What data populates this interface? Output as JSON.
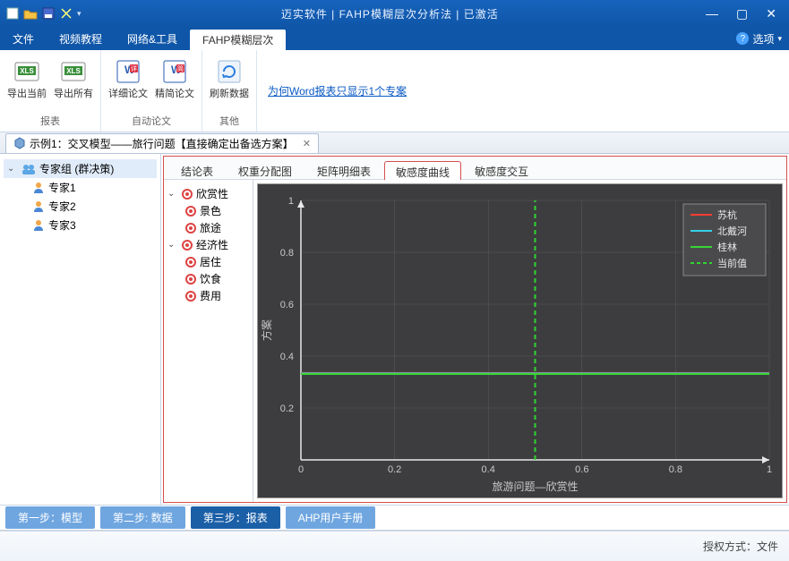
{
  "title": "迈实软件 | FAHP模糊层次分析法 | 已激活",
  "menu": {
    "file": "文件",
    "video": "视频教程",
    "net": "网络&工具",
    "fahp": "FAHP模糊层次",
    "options": "选项"
  },
  "ribbon": {
    "export_current": "导出当前",
    "export_all": "导出所有",
    "detail_paper": "详细论文",
    "simple_paper": "精简论文",
    "refresh": "刷新数据",
    "group_report": "报表",
    "group_autopaper": "自动论文",
    "group_other": "其他",
    "link": "为何Word报表只显示1个专案"
  },
  "doc_tab": {
    "label": "示例1：交叉模型——旅行问题【直接确定出备选方案】"
  },
  "left_tree": {
    "root": "专家组 (群决策)",
    "items": [
      "专家1",
      "专家2",
      "专家3"
    ]
  },
  "sub_tabs": [
    "结论表",
    "权重分配图",
    "矩阵明细表",
    "敏感度曲线",
    "敏感度交互"
  ],
  "crit_tree": {
    "n1": {
      "label": "欣赏性",
      "children": [
        "景色",
        "旅途"
      ]
    },
    "n2": {
      "label": "经济性",
      "children": [
        "居住",
        "饮食",
        "费用"
      ]
    }
  },
  "chart_data": {
    "type": "line",
    "title": "",
    "xlabel": "旅游问题—欣赏性",
    "ylabel": "方案",
    "xlim": [
      0,
      1
    ],
    "ylim": [
      0,
      1
    ],
    "x_ticks": [
      0,
      0.2,
      0.4,
      0.6,
      0.8,
      1
    ],
    "y_ticks": [
      0.2,
      0.4,
      0.6,
      0.8,
      1
    ],
    "series": [
      {
        "name": "苏杭",
        "color": "#ff3b30",
        "x": [
          0,
          1
        ],
        "y": [
          0.335,
          0.335
        ]
      },
      {
        "name": "北戴河",
        "color": "#35d0e6",
        "x": [
          0,
          1
        ],
        "y": [
          0.333,
          0.333
        ]
      },
      {
        "name": "桂林",
        "color": "#36d636",
        "x": [
          0,
          1
        ],
        "y": [
          0.331,
          0.331
        ]
      },
      {
        "name": "当前值",
        "color": "#2fd62f",
        "style": "dashed-vertical",
        "x": 0.5,
        "yrange": [
          0,
          1
        ]
      }
    ],
    "legend_position": "top-right"
  },
  "steps": {
    "s1": "第一步：模型",
    "s2": "第二步: 数据",
    "s3": "第三步：报表",
    "manual": "AHP用户手册"
  },
  "status": "授权方式：文件"
}
